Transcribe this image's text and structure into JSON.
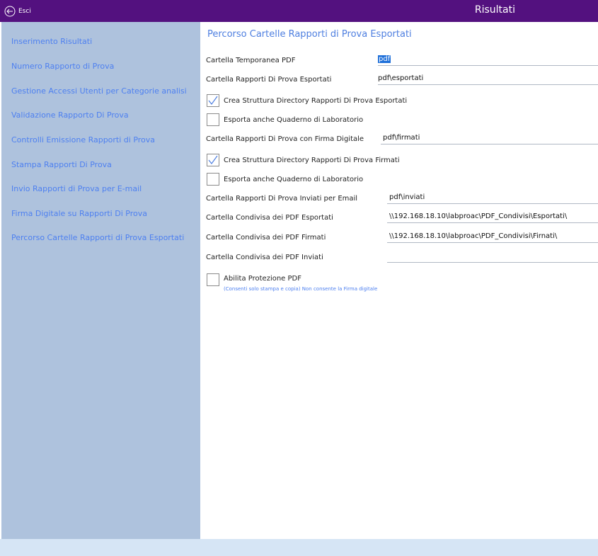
{
  "titlebar": {
    "exit_label": "Esci",
    "title": "Risultati"
  },
  "sidebar": {
    "items": [
      "Inserimento Risultati",
      "Numero Rapporto di Prova",
      "Gestione Accessi Utenti per Categorie analisi",
      "Validazione Rapporto Di Prova",
      "Controlli  Emissione Rapporti di Prova",
      "Stampa Rapporti Di Prova",
      "Invio Rapporti di Prova per E-mail",
      "Firma Digitale su Rapporti Di Prova",
      "Percorso Cartelle Rapporti di Prova Esportati"
    ]
  },
  "main": {
    "title": "Percorso Cartelle Rapporti di Prova Esportati",
    "temp_label": "Cartella Temporanea PDF",
    "temp_value": "pdf",
    "exported_label": "Cartella Rapporti Di Prova Esportati",
    "exported_value": "pdf\\esportati",
    "create_exported_label": "Crea Struttura Directory Rapporti Di Prova Esportati",
    "create_exported_checked": true,
    "export_notebook1_label": "Esporta anche Quaderno di Laboratorio",
    "export_notebook1_checked": false,
    "signed_label": "Cartella Rapporti Di Prova con Firma Digitale",
    "signed_value": "pdf\\firmati",
    "create_signed_label": "Crea Struttura Directory Rapporti Di Prova Firmati",
    "create_signed_checked": true,
    "export_notebook2_label": "Esporta anche Quaderno di Laboratorio",
    "export_notebook2_checked": false,
    "sent_label": "Cartella Rapporti Di Prova Inviati per Email",
    "sent_value": "pdf\\inviati",
    "shared_exported_label": "Cartella Condivisa dei PDF Esportati",
    "shared_exported_value": "\\\\192.168.18.10\\labproac\\PDF_Condivisi\\Esportati\\",
    "shared_signed_label": "Cartella Condivisa dei PDF Firmati",
    "shared_signed_value": "\\\\192.168.18.10\\labproac\\PDF_Condivisi\\Firnati\\",
    "shared_sent_label": "Cartella Condivisa dei PDF Inviati",
    "shared_sent_value": "",
    "protect_label": "Abilita Protezione PDF",
    "protect_checked": false,
    "protect_note": "(Consenti solo stampa e copia) Non consente la Firma digitale"
  },
  "colors": {
    "titlebar": "#53117f",
    "sidebar": "#aec2dd",
    "accent": "#4e80f0",
    "bottombar": "#d6e5f5"
  }
}
